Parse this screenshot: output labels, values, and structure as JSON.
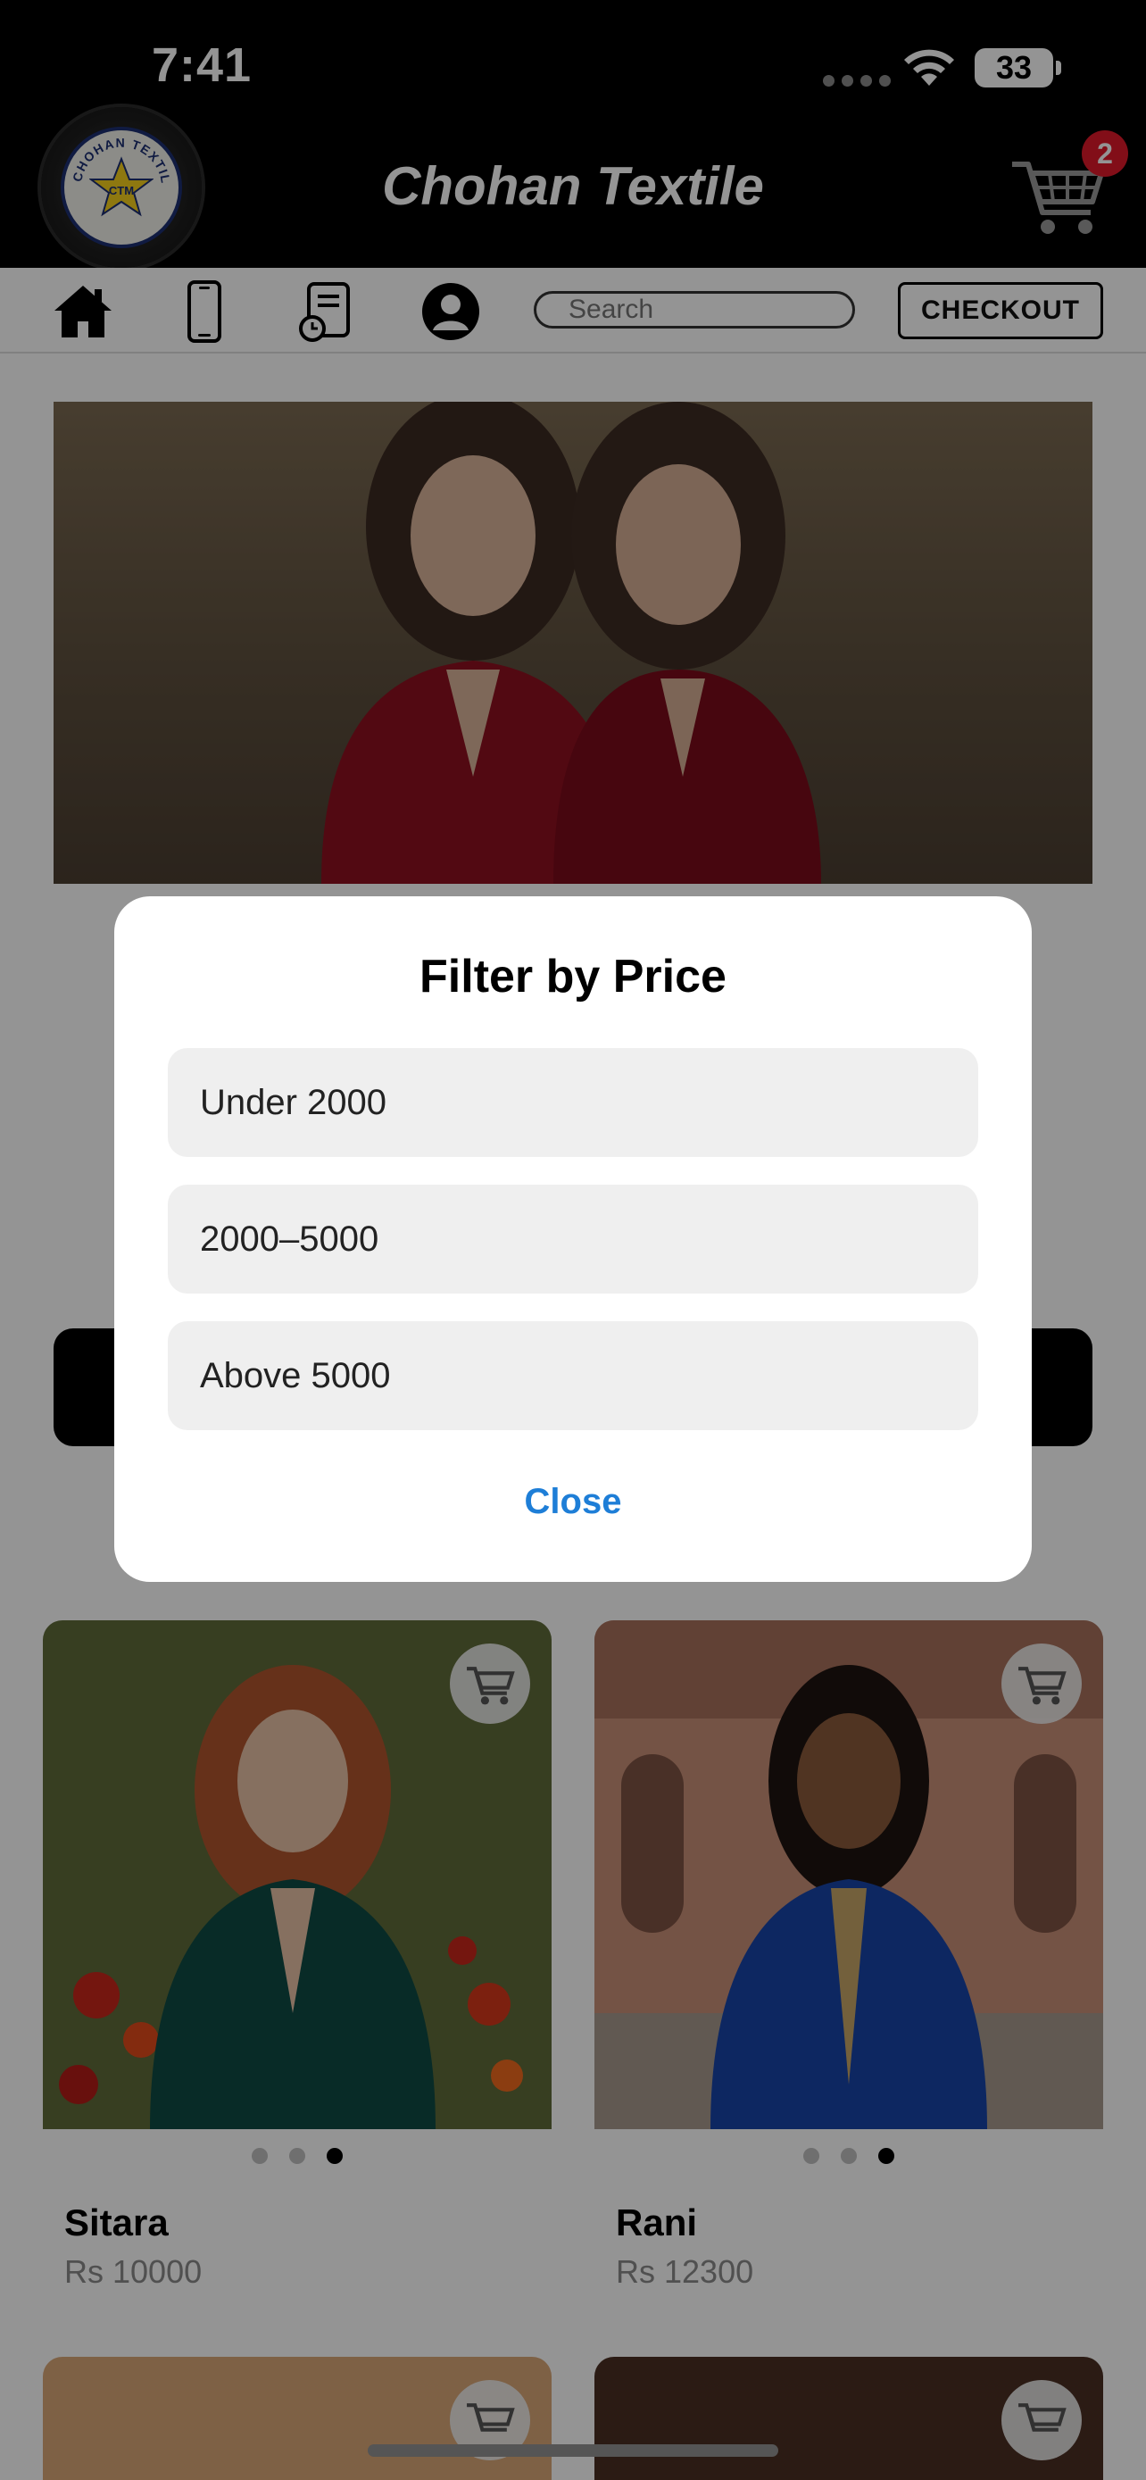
{
  "status_bar": {
    "time": "7:41",
    "battery": "33"
  },
  "header": {
    "title": "Chohan Textile",
    "cart_count": "2",
    "logo_text": "CHOHAN TEXTILE",
    "logo_initials": "CTM"
  },
  "toolbar": {
    "icons": [
      "home-icon",
      "phone-icon",
      "order-history-icon",
      "profile-icon"
    ],
    "search_placeholder": "Search",
    "checkout_label": "CHECKOUT"
  },
  "modal": {
    "title": "Filter by Price",
    "options": [
      "Under 2000",
      "2000–5000",
      "Above 5000"
    ],
    "close_label": "Close"
  },
  "products": [
    {
      "name": "Sitara",
      "price": "Rs 10000",
      "active_image": 3,
      "image_count": 3
    },
    {
      "name": "Rani",
      "price": "Rs 12300",
      "active_image": 3,
      "image_count": 3
    }
  ],
  "colors": {
    "accent": "#1e7ed7",
    "badge": "#e1192a",
    "header_bg": "#000000"
  }
}
